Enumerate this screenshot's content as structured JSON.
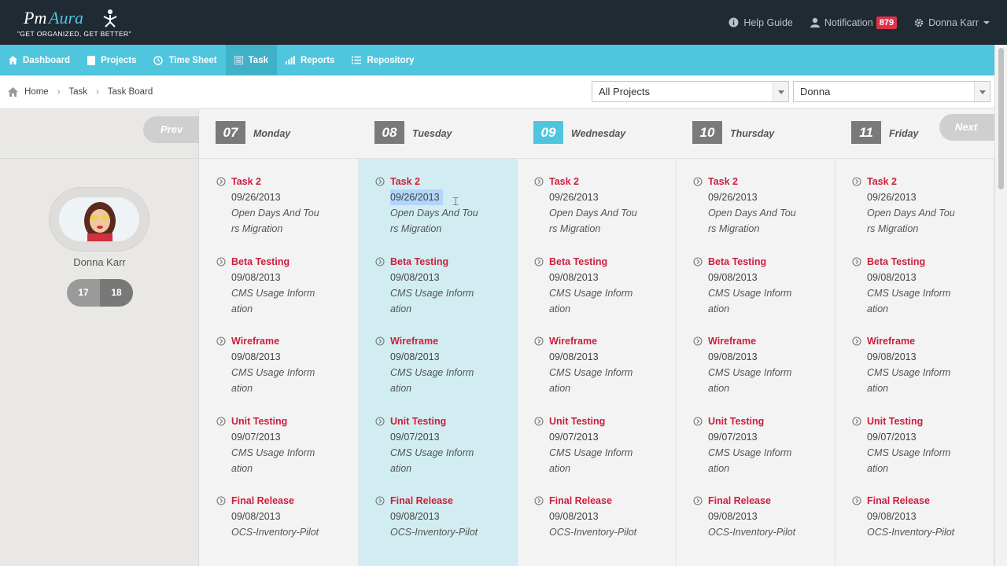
{
  "brand": {
    "name_part1": "Pm",
    "name_part2": "Aura",
    "tagline": "\"GET ORGANIZED, GET BETTER\""
  },
  "topbar": {
    "help_label": "Help Guide",
    "notification_label": "Notification",
    "notification_count": "879",
    "user_label": "Donna Karr"
  },
  "nav": {
    "dashboard": "Dashboard",
    "projects": "Projects",
    "timesheet": "Time Sheet",
    "task": "Task",
    "reports": "Reports",
    "repository": "Repository"
  },
  "breadcrumb": {
    "home": "Home",
    "task": "Task",
    "board": "Task Board"
  },
  "filters": {
    "project": "All Projects",
    "user": "Donna"
  },
  "sidebar": {
    "prev_label": "Prev",
    "user_name": "Donna Karr",
    "stat1": "17",
    "stat2": "18"
  },
  "next_label": "Next",
  "days": [
    {
      "num": "07",
      "name": "Monday"
    },
    {
      "num": "08",
      "name": "Tuesday"
    },
    {
      "num": "09",
      "name": "Wednesday"
    },
    {
      "num": "10",
      "name": "Thursday"
    },
    {
      "num": "11",
      "name": "Friday"
    }
  ],
  "tasks": [
    {
      "title": "Task 2",
      "date": "09/26/2013",
      "desc": "Open Days And Tours Migration"
    },
    {
      "title": "Beta Testing",
      "date": "09/08/2013",
      "desc": "CMS Usage Information"
    },
    {
      "title": "Wireframe",
      "date": "09/08/2013",
      "desc": "CMS Usage Information"
    },
    {
      "title": "Unit Testing",
      "date": "09/07/2013",
      "desc": "CMS Usage Information"
    },
    {
      "title": "Final Release",
      "date": "09/08/2013",
      "desc": "OCS-Inventory-Pilot"
    }
  ],
  "colors": {
    "accent": "#4fc6dd",
    "topbar": "#1f2a33",
    "task_title": "#cc1f3c",
    "badge": "#e0314a"
  }
}
